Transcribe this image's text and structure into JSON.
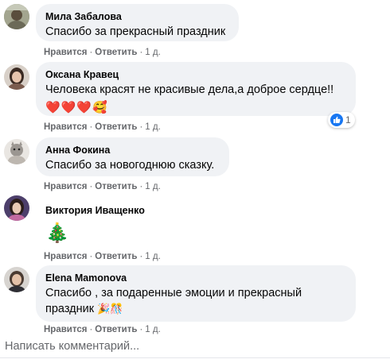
{
  "comments": [
    {
      "author": "Мила Забалова",
      "text": "Спасибо за прекрасный праздник",
      "like": "Нравится",
      "reply": "Ответить",
      "time": "1 д."
    },
    {
      "author": "Оксана Кравец",
      "text": "Человека красят не красивые дела,а доброе сердце!!",
      "emoji": "❤️❤️❤️🥰",
      "like": "Нравится",
      "reply": "Ответить",
      "time": "1 д.",
      "reaction_count": "1"
    },
    {
      "author": "Анна Фокина",
      "text": "Спасибо за новогоднюю сказку.",
      "like": "Нравится",
      "reply": "Ответить",
      "time": "1 д."
    },
    {
      "author": "Виктория Иващенко",
      "emoji": "🎄",
      "like": "Нравится",
      "reply": "Ответить",
      "time": "1 д."
    },
    {
      "author": "Elena Mamonova",
      "text_line1": "Спасибо , за подаренные эмоции и прекрасный",
      "text_line2": "праздник",
      "emoji": "🎉🎊",
      "like": "Нравится",
      "reply": "Ответить",
      "time": "1 д."
    }
  ],
  "write_comment_placeholder": "Написать комментарий...",
  "separator": "·",
  "colors": {
    "bubble": "#f0f2f5",
    "meta": "#65676b",
    "like_blue": "#1877f2"
  },
  "icons": {
    "reaction": "like-icon"
  }
}
